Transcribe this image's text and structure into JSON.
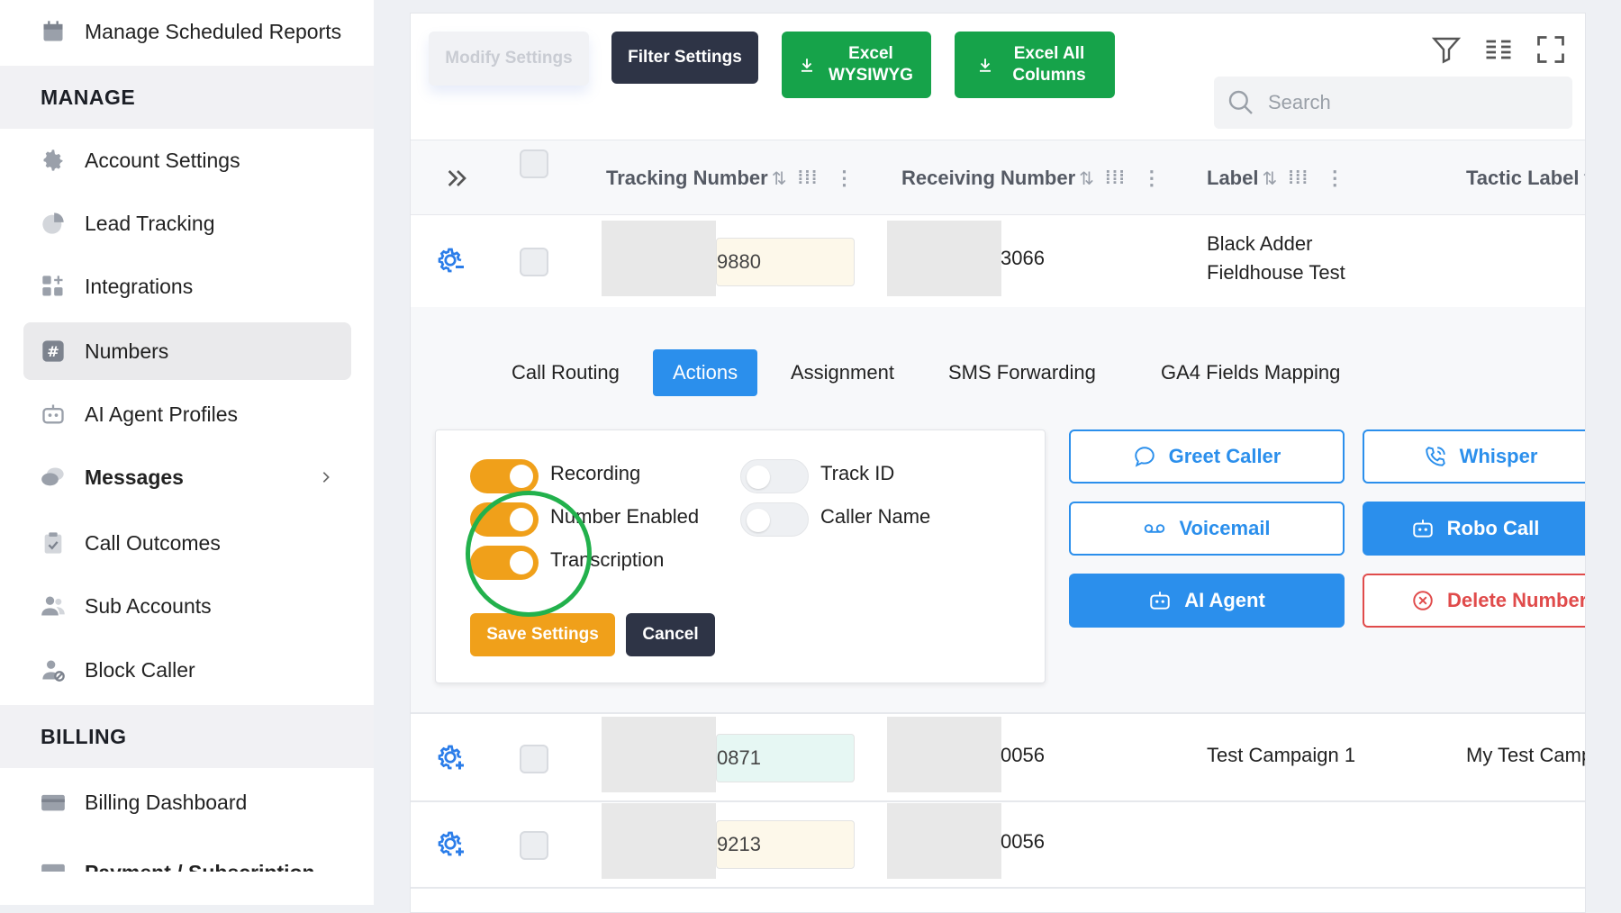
{
  "sidebar": {
    "manage_scheduled_reports": "Manage Scheduled Reports",
    "section_manage": "MANAGE",
    "items": [
      {
        "label": "Account Settings",
        "icon": "gear-icon"
      },
      {
        "label": "Lead Tracking",
        "icon": "pie-chart-icon"
      },
      {
        "label": "Integrations",
        "icon": "grid-plus-icon"
      },
      {
        "label": "Numbers",
        "icon": "hash-icon"
      },
      {
        "label": "AI Agent Profiles",
        "icon": "robot-icon"
      },
      {
        "label": "Messages",
        "icon": "chat-bubbles-icon"
      },
      {
        "label": "Call Outcomes",
        "icon": "clipboard-check-icon"
      },
      {
        "label": "Sub Accounts",
        "icon": "users-icon"
      },
      {
        "label": "Block Caller",
        "icon": "user-block-icon"
      }
    ],
    "section_billing": "BILLING",
    "billing_items": [
      {
        "label": "Billing Dashboard",
        "icon": "credit-card-icon"
      },
      {
        "label": "Payment / Subscription",
        "icon": "card-icon"
      }
    ]
  },
  "toolbar": {
    "modify_settings": "Modify Settings",
    "filter_settings": "Filter Settings",
    "excel_wysiwyg": "Excel WYSIWYG",
    "excel_all_columns": "Excel All Columns",
    "search_placeholder": "Search"
  },
  "table": {
    "columns": [
      "Tracking Number",
      "Receiving Number",
      "Label",
      "Tactic Label"
    ],
    "rows": [
      {
        "tracking": "9880",
        "receiving": "3066",
        "label": "Black Adder Fieldhouse Test",
        "tactic": ""
      },
      {
        "tracking": "0871",
        "receiving": "0056",
        "label": "Test Campaign 1",
        "tactic": "My Test Camp"
      },
      {
        "tracking": "9213",
        "receiving": "0056",
        "label": "",
        "tactic": ""
      }
    ]
  },
  "detail": {
    "tabs": [
      "Call Routing",
      "Actions",
      "Assignment",
      "SMS Forwarding",
      "GA4 Fields Mapping"
    ],
    "active_tab": "Actions",
    "toggles": [
      {
        "label": "Recording",
        "on": true
      },
      {
        "label": "Number Enabled",
        "on": true
      },
      {
        "label": "Transcription",
        "on": true
      },
      {
        "label": "Track ID",
        "on": false
      },
      {
        "label": "Caller Name",
        "on": false
      }
    ],
    "save_settings": "Save Settings",
    "cancel": "Cancel",
    "actions": {
      "greet_caller": "Greet Caller",
      "whisper": "Whisper",
      "voicemail": "Voicemail",
      "robo_call": "Robo Call",
      "ai_agent": "AI Agent",
      "delete_number": "Delete Number"
    }
  },
  "colors": {
    "accent_blue": "#2b8fec",
    "orange": "#f0a01a",
    "green": "#16a34a",
    "dark_navy": "#2e3446",
    "red": "#e04b4b",
    "highlight_circle": "#22b14c"
  }
}
